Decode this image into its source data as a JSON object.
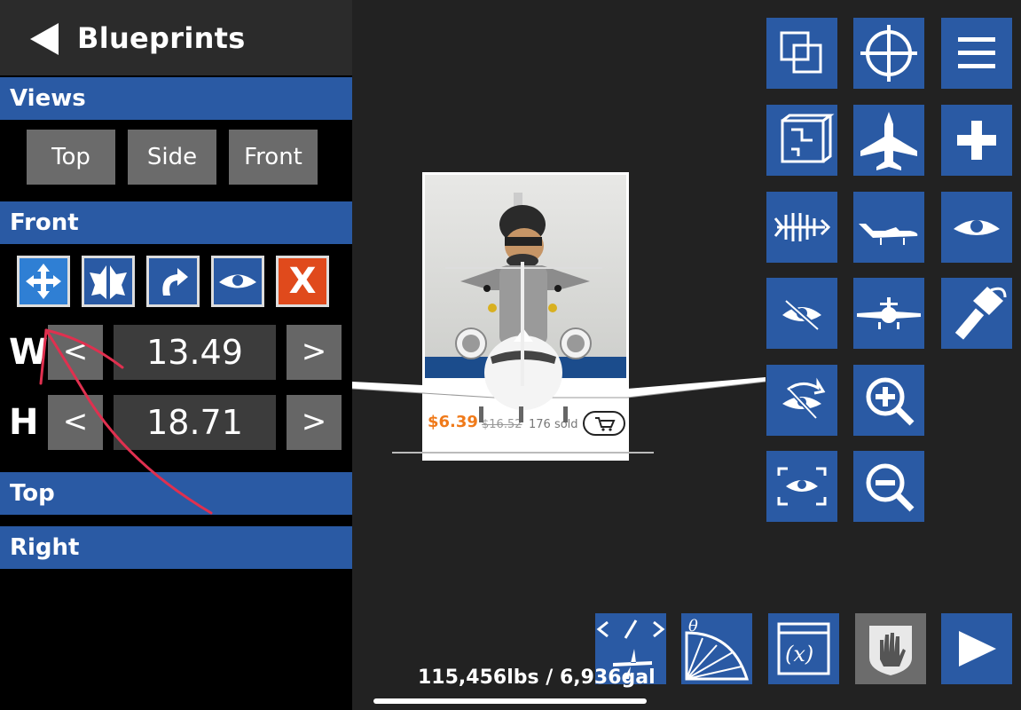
{
  "panel": {
    "title": "Blueprints",
    "sections": {
      "views": "Views",
      "front": "Front",
      "top": "Top",
      "right": "Right"
    },
    "view_buttons": [
      "Top",
      "Side",
      "Front"
    ],
    "dimensions": {
      "w_label": "W",
      "w_value": "13.49",
      "h_label": "H",
      "h_value": "18.71",
      "decrease": "<",
      "increase": ">"
    },
    "delete_label": "X"
  },
  "photo": {
    "price": "$6.39",
    "old_price": "$16.52",
    "sold": "176 sold"
  },
  "status": {
    "weight_fuel": "115,456lbs / 6,936gal"
  },
  "colors": {
    "accent_blue": "#2a5aa4",
    "panel_bg": "#000000",
    "canvas_bg": "#222222",
    "button_gray": "#6b6b6b",
    "delete_red": "#e04a1c",
    "annotation_red": "#e0304f"
  },
  "icons": {
    "grid": [
      "layers-icon",
      "crosshair-icon",
      "menu-icon",
      "blueprint-icon",
      "jet-top-icon",
      "plus-icon",
      "fishbone-icon",
      "jet-side-icon",
      "eye-icon",
      "eye-hidden-icon",
      "plane-front-icon",
      "paint-icon",
      "eye-swap-icon",
      "zoom-in-icon",
      "view-frame-icon",
      "zoom-out-icon"
    ],
    "bottom": [
      "code-plane-icon",
      "angle-icon",
      "variable-icon",
      "touch-icon",
      "play-icon"
    ]
  }
}
